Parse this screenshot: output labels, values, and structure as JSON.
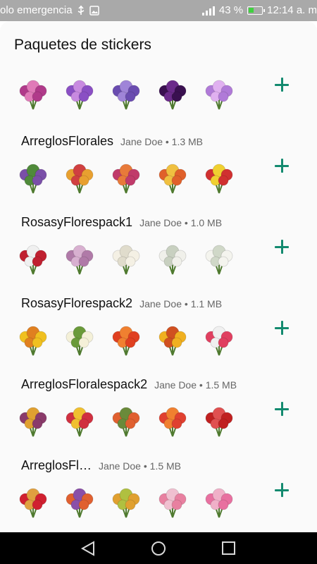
{
  "status_bar": {
    "left_text": "olo emergencia",
    "battery_text": "43 %",
    "battery_level": 0.43,
    "time": "12:14 a. m",
    "icons": [
      "usb-icon",
      "image-icon",
      "signal-icon",
      "battery-charging-icon"
    ]
  },
  "page_title": "Paquetes de stickers",
  "packs": [
    {
      "name": "",
      "author": "",
      "size": "",
      "sticker_colors": [
        [
          "#b03a8a",
          "#e07ab8"
        ],
        [
          "#8a4fc4",
          "#c88ae0"
        ],
        [
          "#6a4cb0",
          "#9f84d8"
        ],
        [
          "#3a1050",
          "#6b2a8a"
        ],
        [
          "#b07ad8",
          "#e0b0f0"
        ]
      ]
    },
    {
      "name": "ArreglosFlorales",
      "author": "Jane Doe",
      "size": "1.3 MB",
      "sticker_colors": [
        [
          "#7a4fa8",
          "#4f8a3a"
        ],
        [
          "#e8a030",
          "#d04040"
        ],
        [
          "#c03a6a",
          "#e87a3a"
        ],
        [
          "#e0602a",
          "#f0c040"
        ],
        [
          "#d03030",
          "#f0d030"
        ]
      ]
    },
    {
      "name": "RosasyFlorespack1",
      "author": "Jane Doe",
      "size": "1.0 MB",
      "sticker_colors": [
        [
          "#c02030",
          "#f0f0f0"
        ],
        [
          "#b07aa8",
          "#d8b0d0"
        ],
        [
          "#f4f0e4",
          "#e0dccc"
        ],
        [
          "#f0f0ea",
          "#c8d0c0"
        ],
        [
          "#f4f4ee",
          "#d0d8c8"
        ]
      ]
    },
    {
      "name": "RosasyFlorespack2",
      "author": "Jane Doe",
      "size": "1.1 MB",
      "sticker_colors": [
        [
          "#f0c020",
          "#e08020"
        ],
        [
          "#f4f0d8",
          "#6a9a3a"
        ],
        [
          "#e04020",
          "#f08030"
        ],
        [
          "#f0b020",
          "#d05020"
        ],
        [
          "#e04060",
          "#f0f0f0"
        ]
      ]
    },
    {
      "name": "ArreglosFloralespack2",
      "author": "Jane Doe",
      "size": "1.5 MB",
      "sticker_colors": [
        [
          "#8a3a6a",
          "#e0a030"
        ],
        [
          "#d03040",
          "#f0c030"
        ],
        [
          "#e06030",
          "#6a8a3a"
        ],
        [
          "#e04030",
          "#f08030"
        ],
        [
          "#c02020",
          "#e05050"
        ]
      ]
    },
    {
      "name": "ArreglosFl…",
      "author": "Jane Doe",
      "size": "1.5 MB",
      "sticker_colors": [
        [
          "#d02030",
          "#e0a040"
        ],
        [
          "#e06030",
          "#8a4fa8"
        ],
        [
          "#e0a030",
          "#b0c040"
        ],
        [
          "#e880a0",
          "#f0c0d0"
        ],
        [
          "#e870a0",
          "#f0b0c8"
        ]
      ]
    }
  ],
  "navbar": {
    "icons": [
      "back-icon",
      "home-icon",
      "recents-icon"
    ]
  },
  "colors": {
    "accent": "#138a6f",
    "status_bar": "#a9a9a9",
    "nav_bar": "#000000"
  }
}
